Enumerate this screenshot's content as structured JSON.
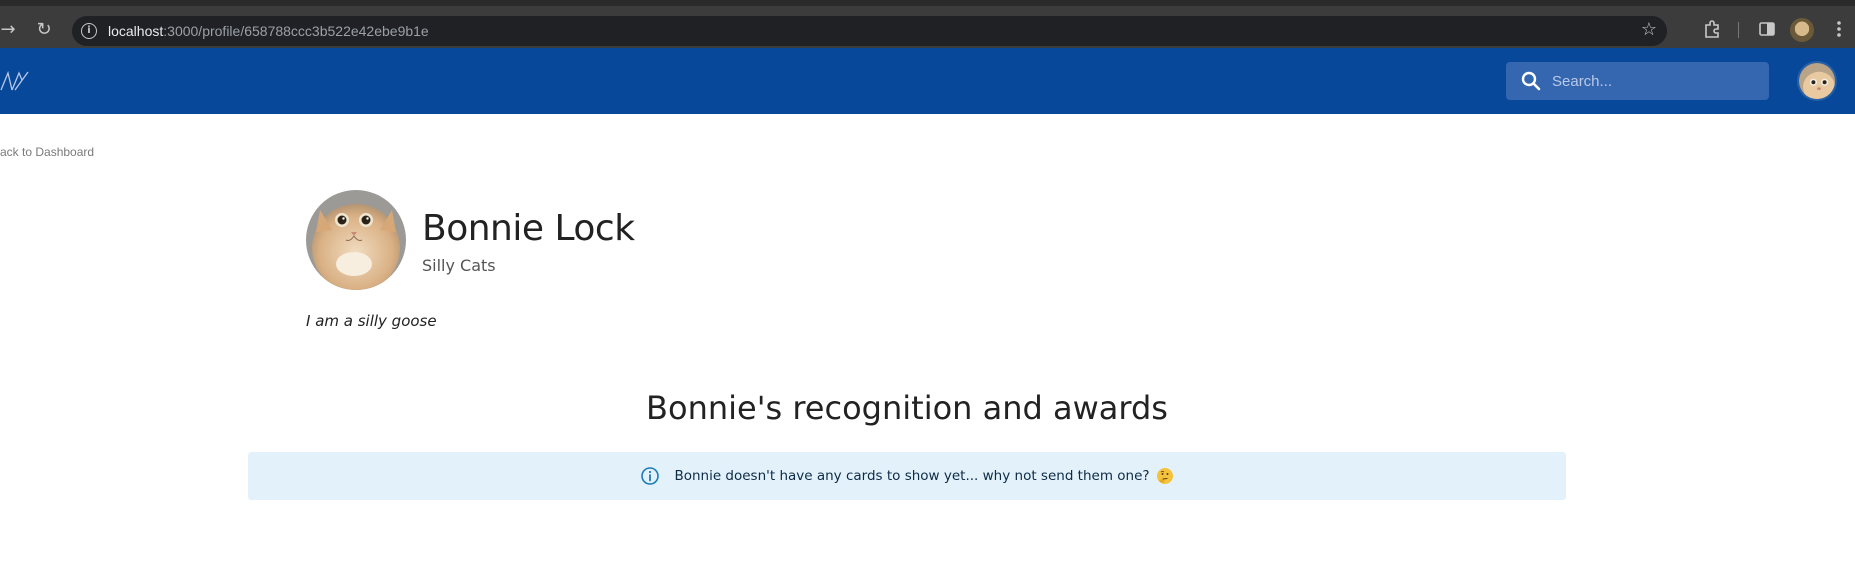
{
  "browser": {
    "url_host": "localhost",
    "url_rest": ":3000/profile/658788ccc3b522e42ebe9b1e"
  },
  "header": {
    "search_placeholder": "Search...",
    "brand_color": "#08489a"
  },
  "nav": {
    "back_label": "ack to Dashboard"
  },
  "profile": {
    "name": "Bonnie Lock",
    "team": "Silly Cats",
    "bio": "I am a silly goose"
  },
  "awards": {
    "heading": "Bonnie's recognition and awards",
    "empty_message": "Bonnie doesn't have any cards to show yet... why not send them one?",
    "alert_color": "#e3f2fa"
  },
  "icons": {
    "forward": "forward-arrow-icon",
    "reload": "reload-icon",
    "site_info": "info-icon",
    "bookmark": "star-icon",
    "extensions": "puzzle-icon",
    "sidebar": "side-panel-icon",
    "menu": "kebab-menu-icon",
    "logo": "app-logo-icon",
    "search": "search-icon",
    "alert": "info-circle-icon",
    "emoji": "thinking-face-emoji"
  }
}
